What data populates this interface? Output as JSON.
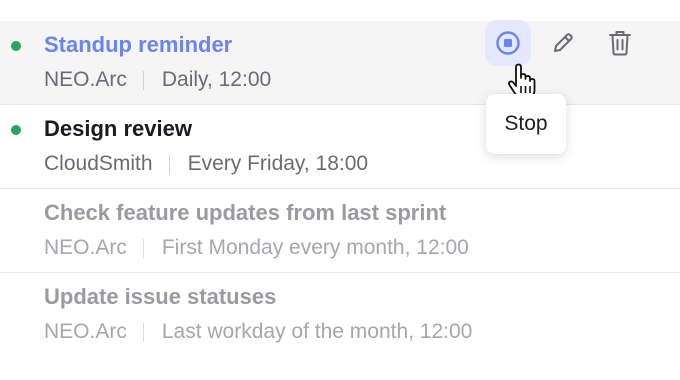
{
  "colors": {
    "status_active": "#27a65a",
    "accent": "#6a84f2",
    "stop_button_bg": "#e5e7fb"
  },
  "reminders": [
    {
      "title": "Standup reminder",
      "project": "NEO.Arc",
      "schedule": "Daily, 12:00",
      "status": "active"
    },
    {
      "title": "Design review",
      "project": "CloudSmith",
      "schedule": "Every Friday, 18:00",
      "status": "active"
    },
    {
      "title": "Check feature updates from last sprint",
      "project": "NEO.Arc",
      "schedule": "First Monday every month, 12:00",
      "status": "inactive"
    },
    {
      "title": "Update issue statuses",
      "project": "NEO.Arc",
      "schedule": "Last workday of the month, 12:00",
      "status": "inactive"
    }
  ],
  "row_actions": {
    "stop_icon": "stop-circle-icon",
    "edit_icon": "pencil-icon",
    "delete_icon": "trash-icon"
  },
  "tooltip": {
    "label": "Stop"
  },
  "cursor": {
    "icon": "hand-pointer-cursor-icon"
  }
}
